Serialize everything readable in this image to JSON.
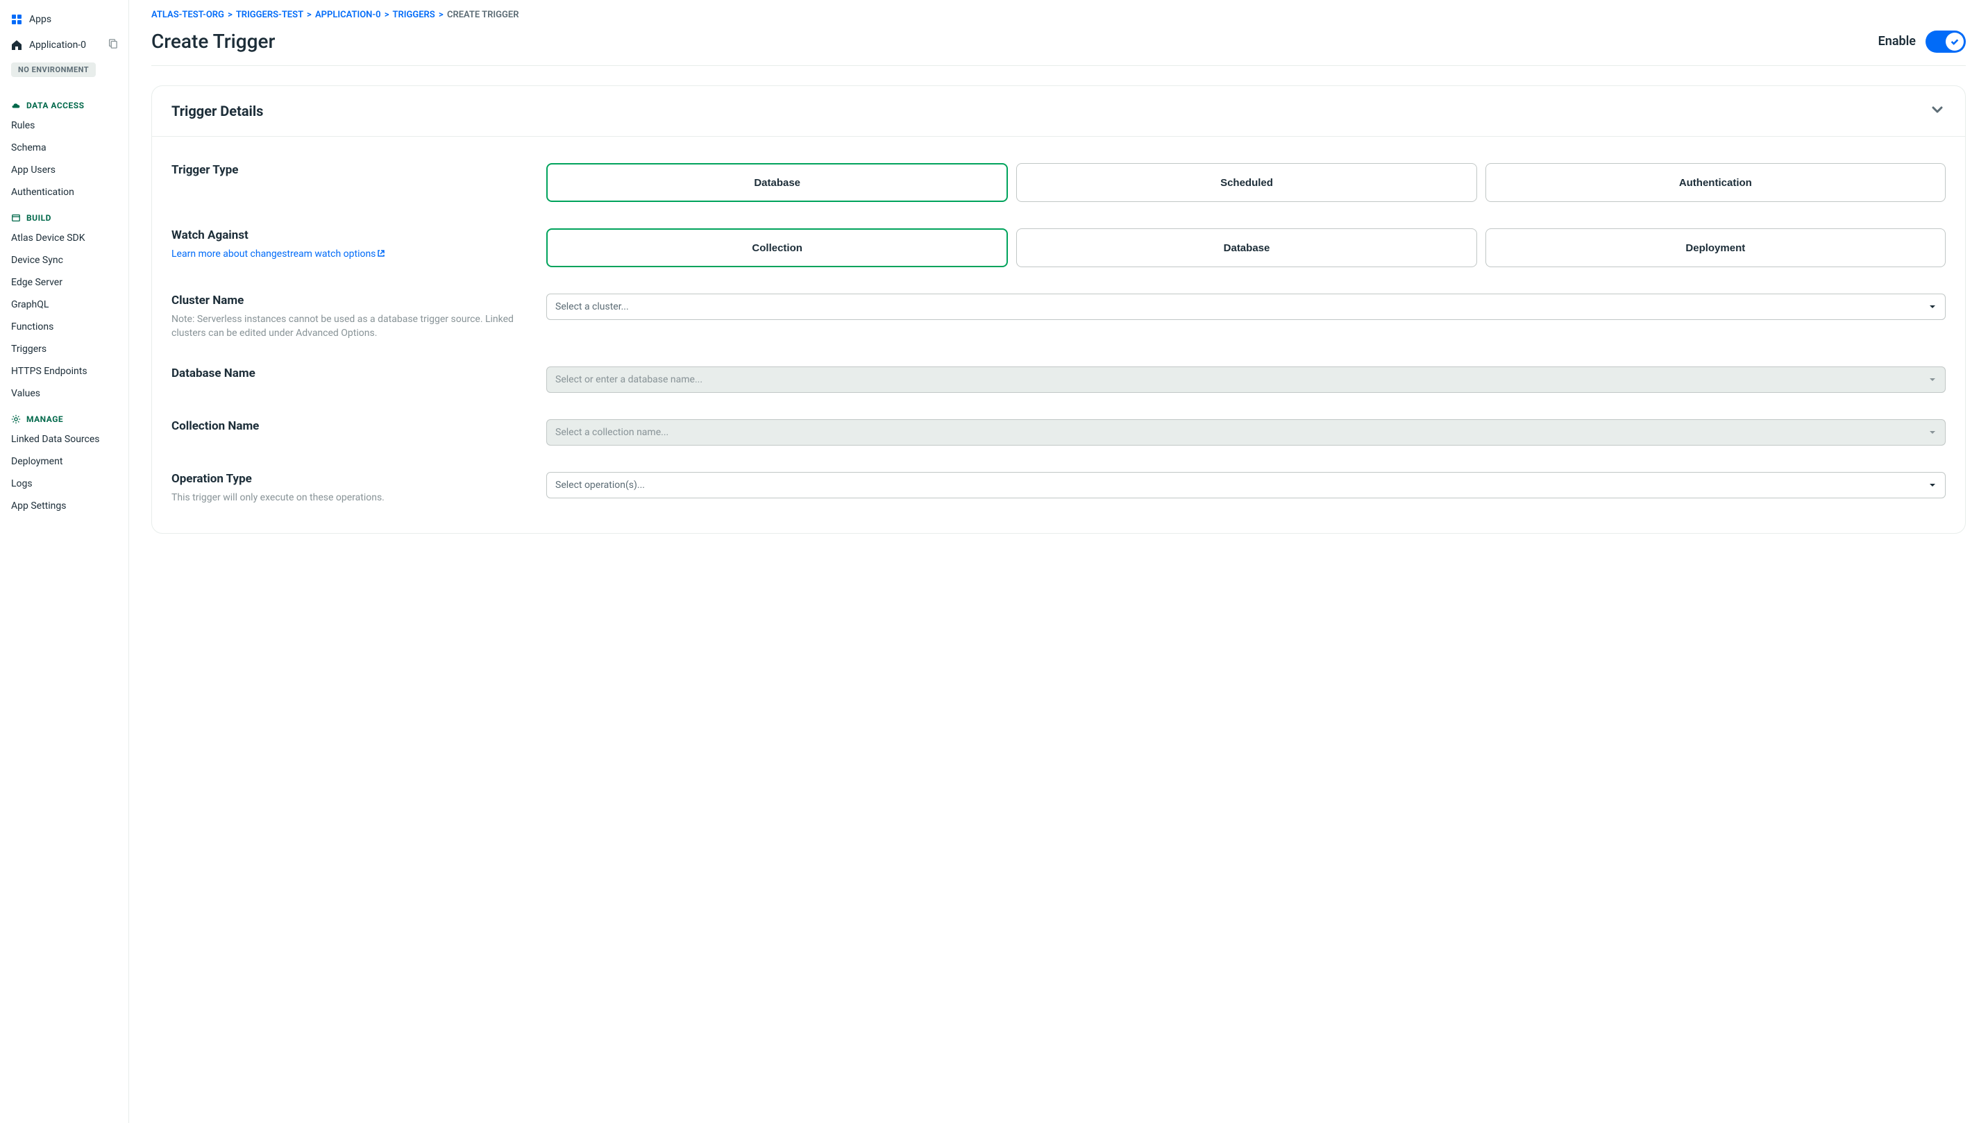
{
  "sidebar": {
    "apps_label": "Apps",
    "app_name": "Application-0",
    "env_badge": "NO ENVIRONMENT",
    "sections": {
      "data_access": {
        "title": "DATA ACCESS",
        "items": [
          "Rules",
          "Schema",
          "App Users",
          "Authentication"
        ]
      },
      "build": {
        "title": "BUILD",
        "items": [
          "Atlas Device SDK",
          "Device Sync",
          "Edge Server",
          "GraphQL",
          "Functions",
          "Triggers",
          "HTTPS Endpoints",
          "Values"
        ]
      },
      "manage": {
        "title": "MANAGE",
        "items": [
          "Linked Data Sources",
          "Deployment",
          "Logs",
          "App Settings"
        ]
      }
    }
  },
  "breadcrumb": {
    "org": "ATLAS-TEST-ORG",
    "project": "TRIGGERS-TEST",
    "app": "APPLICATION-0",
    "triggers": "TRIGGERS",
    "current": "CREATE TRIGGER"
  },
  "page": {
    "title": "Create Trigger",
    "enable_label": "Enable"
  },
  "details": {
    "section_title": "Trigger Details",
    "trigger_type": {
      "label": "Trigger Type",
      "options": [
        "Database",
        "Scheduled",
        "Authentication"
      ]
    },
    "watch_against": {
      "label": "Watch Against",
      "link_text": "Learn more about changestream watch options",
      "options": [
        "Collection",
        "Database",
        "Deployment"
      ]
    },
    "cluster_name": {
      "label": "Cluster Name",
      "note": "Note: Serverless instances cannot be used as a database trigger source. Linked clusters can be edited under Advanced Options.",
      "placeholder": "Select a cluster..."
    },
    "database_name": {
      "label": "Database Name",
      "placeholder": "Select or enter a database name..."
    },
    "collection_name": {
      "label": "Collection Name",
      "placeholder": "Select a collection name..."
    },
    "operation_type": {
      "label": "Operation Type",
      "note": "This trigger will only execute on these operations.",
      "placeholder": "Select operation(s)..."
    }
  }
}
